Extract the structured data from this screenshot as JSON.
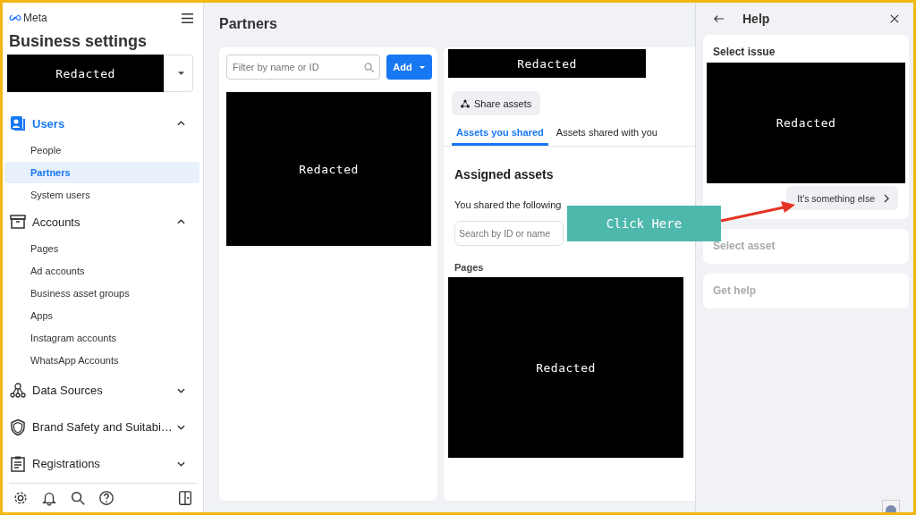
{
  "sidebar": {
    "brand": "Meta",
    "title": "Business settings",
    "account_selector": {
      "redaction": "Redacted"
    },
    "sections": [
      {
        "label": "Users",
        "selected": true,
        "expanded": true,
        "items": [
          {
            "label": "People",
            "selected": false
          },
          {
            "label": "Partners",
            "selected": true
          },
          {
            "label": "System users",
            "selected": false
          }
        ]
      },
      {
        "label": "Accounts",
        "selected": false,
        "expanded": true,
        "items": [
          {
            "label": "Pages",
            "selected": false
          },
          {
            "label": "Ad accounts",
            "selected": false
          },
          {
            "label": "Business asset groups",
            "selected": false
          },
          {
            "label": "Apps",
            "selected": false
          },
          {
            "label": "Instagram accounts",
            "selected": false
          },
          {
            "label": "WhatsApp Accounts",
            "selected": false
          }
        ]
      },
      {
        "label": "Data Sources",
        "selected": false,
        "expanded": false
      },
      {
        "label": "Brand Safety and Suitabi…",
        "selected": false,
        "expanded": false
      },
      {
        "label": "Registrations",
        "selected": false,
        "expanded": false
      }
    ]
  },
  "page": {
    "title": "Partners",
    "partner_list": {
      "filter": {
        "placeholder": "Filter by name or ID"
      },
      "add_button": "Add",
      "redaction": "Redacted"
    },
    "partner_detail": {
      "redaction": "Redacted",
      "share_button": "Share assets",
      "tabs": [
        {
          "label": "Assets you shared",
          "selected": true
        },
        {
          "label": "Assets shared with you",
          "selected": false
        }
      ],
      "heading": "Assigned assets",
      "description": "You shared the following",
      "search": {
        "placeholder": "Search by ID or name"
      },
      "section_label": "Pages",
      "section_redaction": "Redacted"
    }
  },
  "help_panel": {
    "title": "Help",
    "steps": [
      {
        "title": "Select issue",
        "disabled": false,
        "redaction": "Redacted",
        "option": "It's something else"
      },
      {
        "title": "Select asset",
        "disabled": true
      },
      {
        "title": "Get help",
        "disabled": true
      }
    ]
  },
  "annotation": {
    "label": "Click Here"
  }
}
